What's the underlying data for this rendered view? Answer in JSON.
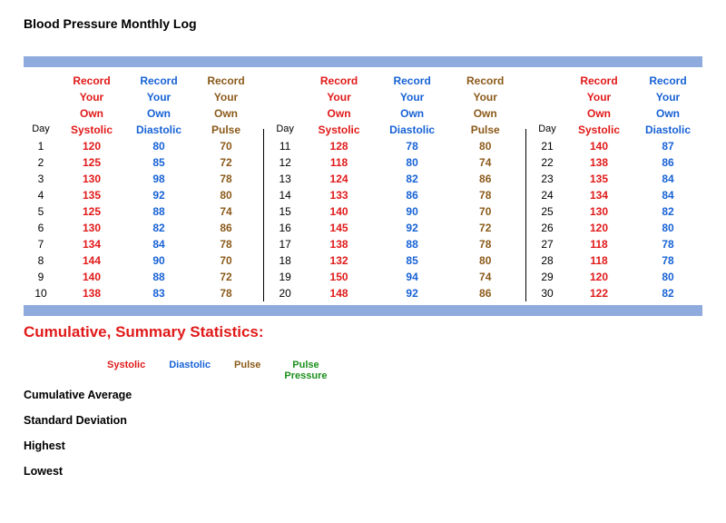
{
  "title": "Blood Pressure Monthly Log",
  "record_lines": [
    "Record",
    "Your",
    "Own"
  ],
  "col_labels": {
    "day": "Day",
    "sys": "Systolic",
    "dia": "Diastolic",
    "pul": "Pulse"
  },
  "block1": [
    {
      "day": 1,
      "sys": 120,
      "dia": 80,
      "pul": 70
    },
    {
      "day": 2,
      "sys": 125,
      "dia": 85,
      "pul": 72
    },
    {
      "day": 3,
      "sys": 130,
      "dia": 98,
      "pul": 78
    },
    {
      "day": 4,
      "sys": 135,
      "dia": 92,
      "pul": 80
    },
    {
      "day": 5,
      "sys": 125,
      "dia": 88,
      "pul": 74
    },
    {
      "day": 6,
      "sys": 130,
      "dia": 82,
      "pul": 86
    },
    {
      "day": 7,
      "sys": 134,
      "dia": 84,
      "pul": 78
    },
    {
      "day": 8,
      "sys": 144,
      "dia": 90,
      "pul": 70
    },
    {
      "day": 9,
      "sys": 140,
      "dia": 88,
      "pul": 72
    },
    {
      "day": 10,
      "sys": 138,
      "dia": 83,
      "pul": 78
    }
  ],
  "block2": [
    {
      "day": 11,
      "sys": 128,
      "dia": 78,
      "pul": 80
    },
    {
      "day": 12,
      "sys": 118,
      "dia": 80,
      "pul": 74
    },
    {
      "day": 13,
      "sys": 124,
      "dia": 82,
      "pul": 86
    },
    {
      "day": 14,
      "sys": 133,
      "dia": 86,
      "pul": 78
    },
    {
      "day": 15,
      "sys": 140,
      "dia": 90,
      "pul": 70
    },
    {
      "day": 16,
      "sys": 145,
      "dia": 92,
      "pul": 72
    },
    {
      "day": 17,
      "sys": 138,
      "dia": 88,
      "pul": 78
    },
    {
      "day": 18,
      "sys": 132,
      "dia": 85,
      "pul": 80
    },
    {
      "day": 19,
      "sys": 150,
      "dia": 94,
      "pul": 74
    },
    {
      "day": 20,
      "sys": 148,
      "dia": 92,
      "pul": 86
    }
  ],
  "block3": [
    {
      "day": 21,
      "sys": 140,
      "dia": 87
    },
    {
      "day": 22,
      "sys": 138,
      "dia": 86
    },
    {
      "day": 23,
      "sys": 135,
      "dia": 84
    },
    {
      "day": 24,
      "sys": 134,
      "dia": 84
    },
    {
      "day": 25,
      "sys": 130,
      "dia": 82
    },
    {
      "day": 26,
      "sys": 120,
      "dia": 80
    },
    {
      "day": 27,
      "sys": 118,
      "dia": 78
    },
    {
      "day": 28,
      "sys": 118,
      "dia": 78
    },
    {
      "day": 29,
      "sys": 120,
      "dia": 80
    },
    {
      "day": 30,
      "sys": 122,
      "dia": 82
    }
  ],
  "summary": {
    "title": "Cumulative, Summary Statistics:",
    "cols": {
      "sys": "Systolic",
      "dia": "Diastolic",
      "pul": "Pulse",
      "pp_line1": "Pulse",
      "pp_line2": "Pressure"
    },
    "rows": [
      "Cumulative Average",
      "Standard Deviation",
      "Highest",
      "Lowest"
    ]
  }
}
